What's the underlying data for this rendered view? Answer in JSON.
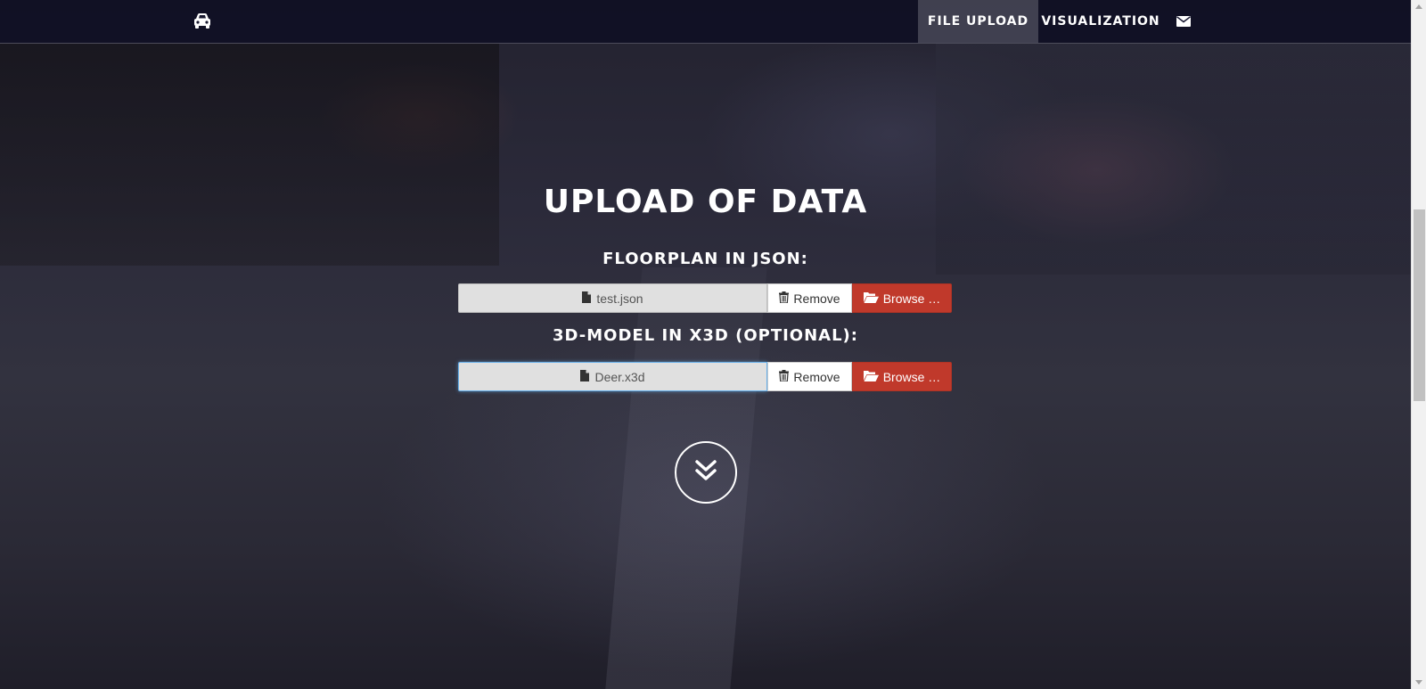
{
  "navbar": {
    "brand_icon": "car-icon",
    "items": [
      {
        "label": "FILE UPLOAD",
        "active": true
      },
      {
        "label": "VISUALIZATION",
        "active": false
      }
    ],
    "mail_icon": "envelope-icon"
  },
  "main": {
    "title": "UPLOAD OF DATA",
    "uploads": [
      {
        "label": "FLOORPLAN IN JSON:",
        "file_name": "test.json",
        "remove_label": "Remove",
        "browse_label": "Browse …"
      },
      {
        "label": "3D-MODEL IN X3D (OPTIONAL):",
        "file_name": "Deer.x3d",
        "remove_label": "Remove",
        "browse_label": "Browse …"
      }
    ],
    "scroll_icon": "double-chevron-down-icon"
  },
  "colors": {
    "navbar_bg": "#0f0f23",
    "accent_browse": "#c0392b",
    "focus_border": "#66afe9"
  }
}
